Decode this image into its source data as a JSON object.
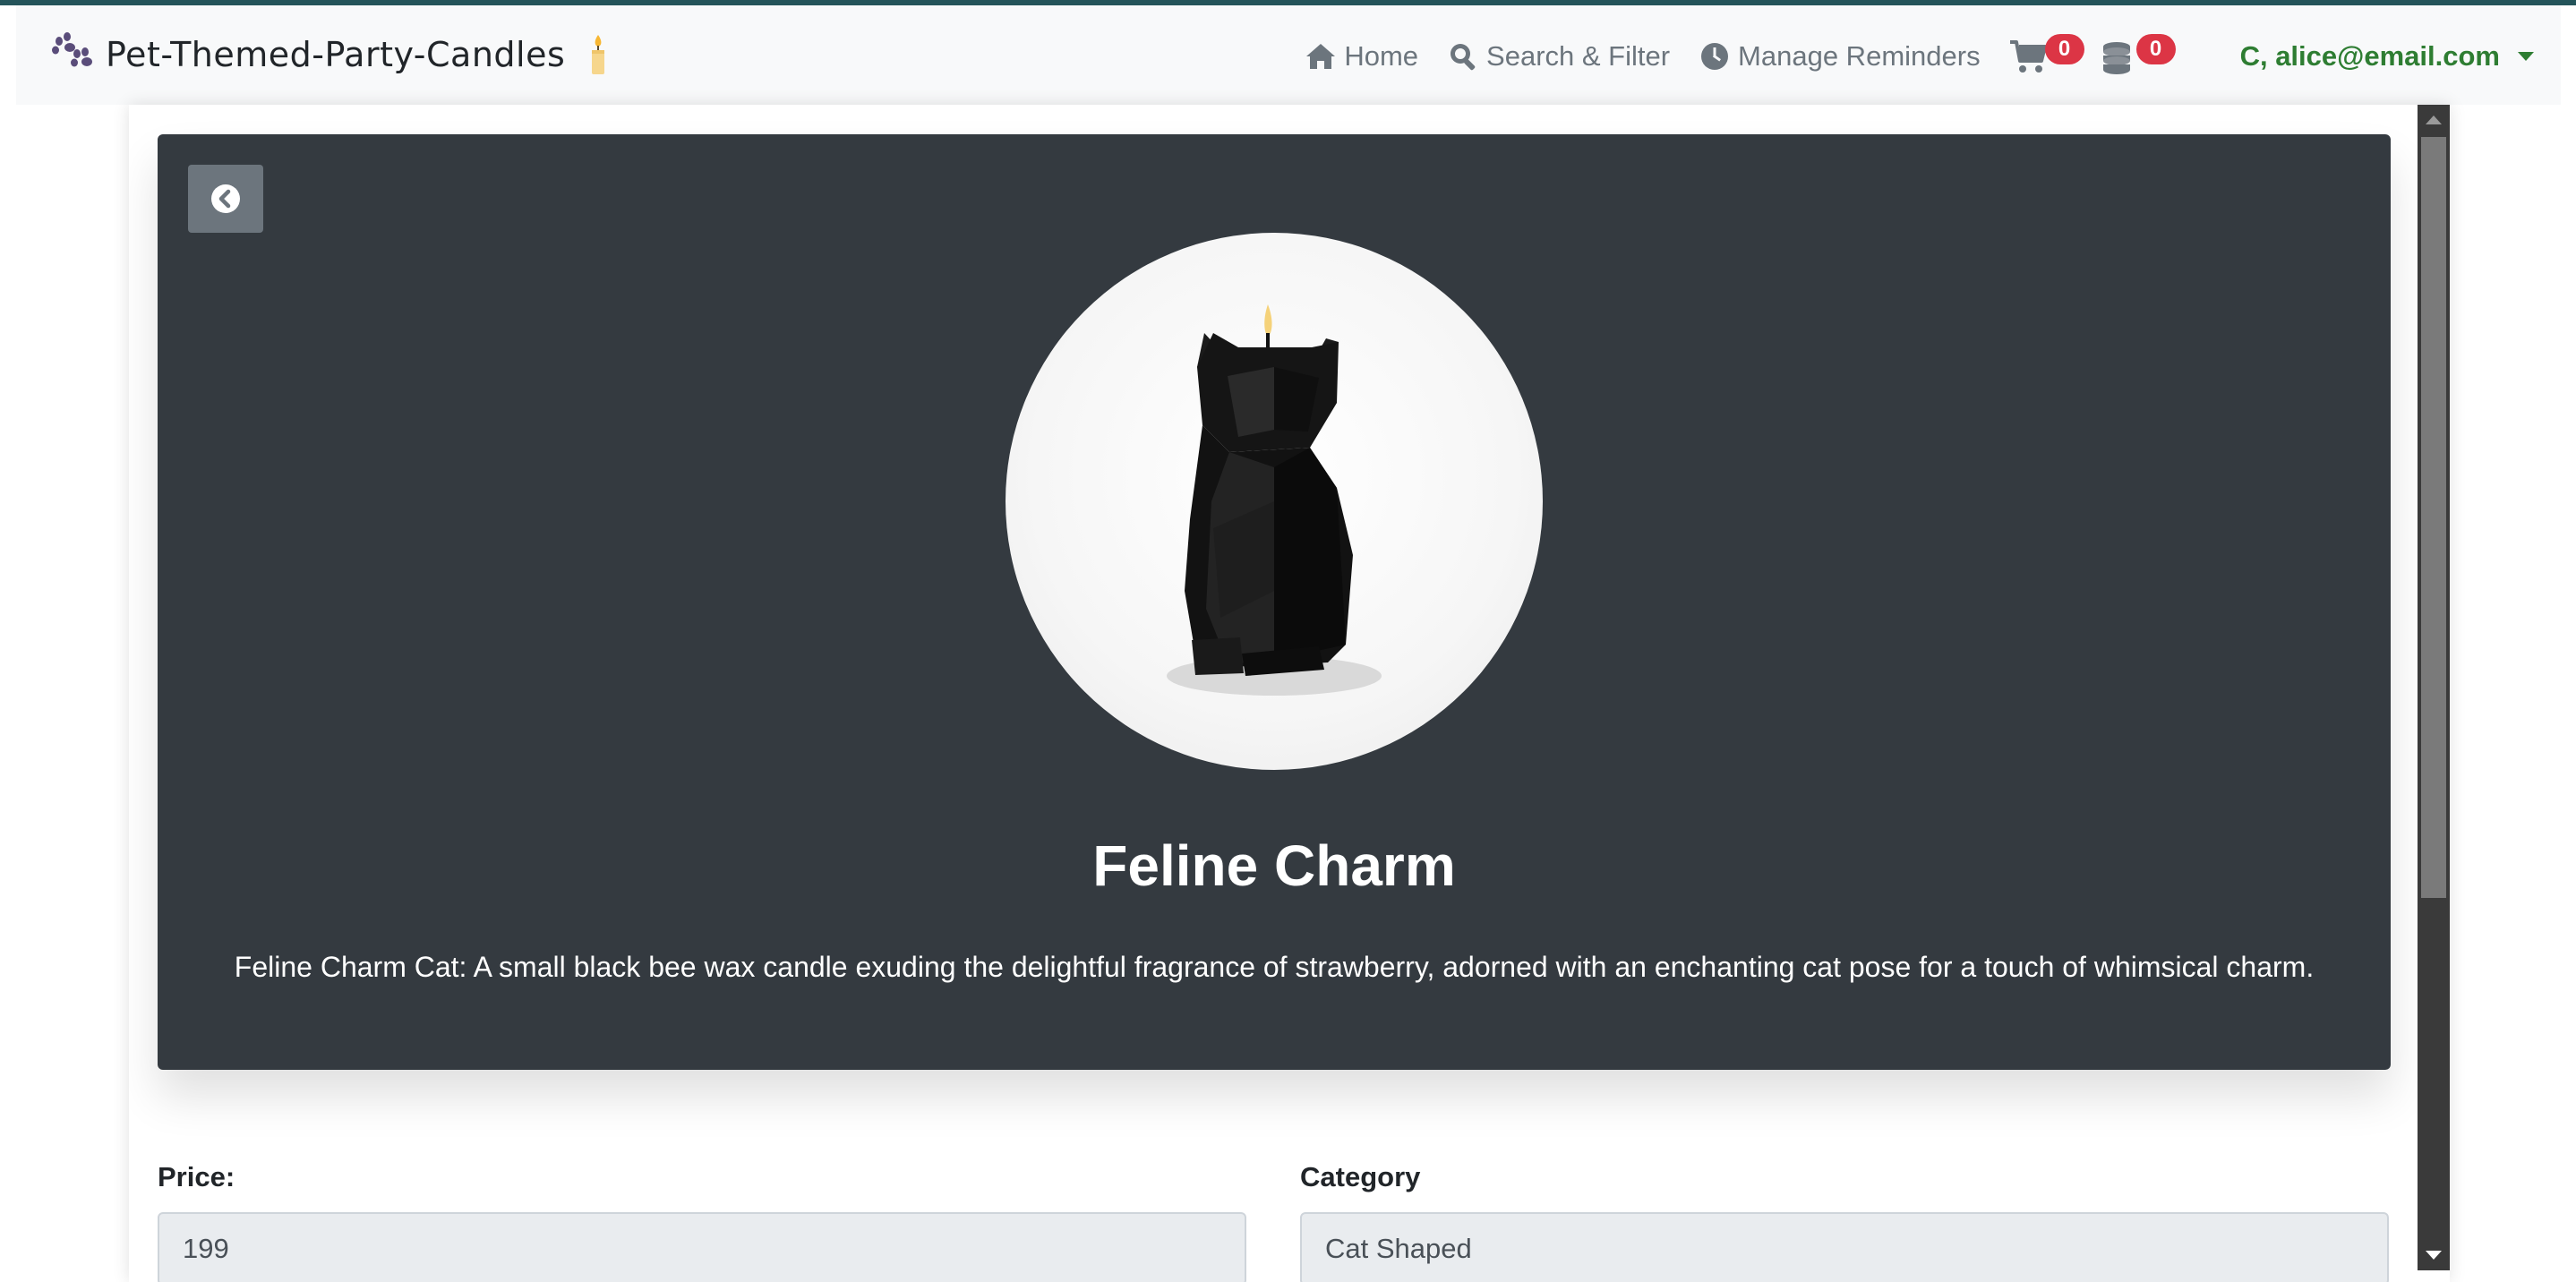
{
  "brand": {
    "name": "Pet-Themed-Party-Candles",
    "logo_icon": "paw-icon",
    "candle_icon": "candle-icon"
  },
  "nav": {
    "home_label": "Home",
    "search_label": "Search & Filter",
    "reminders_label": "Manage Reminders",
    "cart_count": "0",
    "coins_count": "0",
    "user_label": "C, alice@email.com"
  },
  "product": {
    "title": "Feline Charm",
    "description": "Feline Charm Cat: A small black bee wax candle exuding the delightful fragrance of strawberry, adorned with an enchanting cat pose for a touch of whimsical charm."
  },
  "details": {
    "price_label": "Price:",
    "price_value": "199",
    "category_label": "Category",
    "category_value": "Cat Shaped"
  },
  "colors": {
    "accent_top": "#24545a",
    "hero_bg": "#343a40",
    "badge": "#dc3545",
    "user": "#2e7d32"
  }
}
